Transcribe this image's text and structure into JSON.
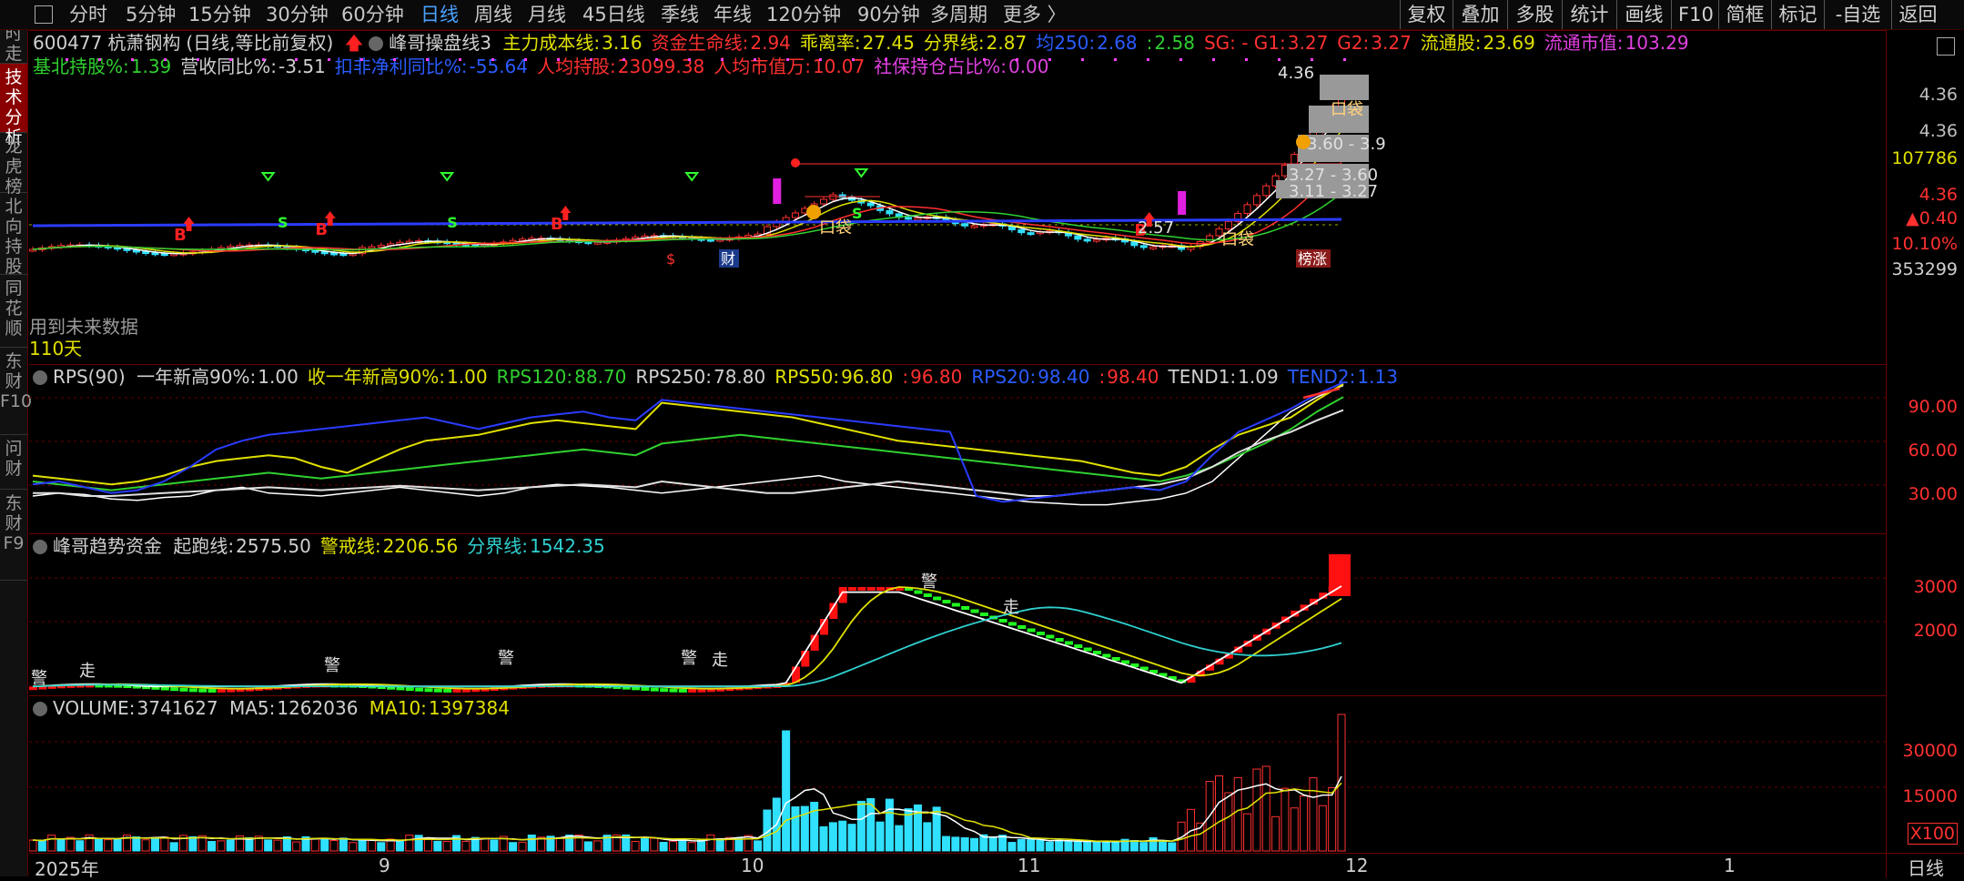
{
  "top_tabs": [
    "分时",
    "5分钟",
    "15分钟",
    "30分钟",
    "60分钟",
    "日线",
    "周线",
    "月线",
    "45日线",
    "季线",
    "年线",
    "120分钟",
    "90分钟",
    "多周期",
    "更多 〉"
  ],
  "active_tab": "日线",
  "right_buttons": [
    "复权",
    "叠加",
    "多股",
    "统计",
    "画线",
    "F10",
    "简框",
    "标记",
    "-自选",
    "返回"
  ],
  "left_tabs": [
    "分时走势",
    "技术分析",
    "龙虎榜",
    "北向持股",
    "同花顺",
    "东财F10",
    "问财",
    "东财F9"
  ],
  "stock": {
    "code": "600477",
    "name": "杭萧钢构",
    "mode": "(日线,等比前复权)",
    "indicator": "峰哥操盘线3",
    "line1": [
      {
        "t": "主力成本线:",
        "v": "3.16",
        "c": "#e0e000"
      },
      {
        "t": "资金生命线:",
        "v": "2.94",
        "c": "#ff3030"
      },
      {
        "t": "乖离率:",
        "v": "27.45",
        "c": "#e0e000"
      },
      {
        "t": "分界线:",
        "v": "2.87",
        "c": "#e0e000"
      },
      {
        "t": "均250:",
        "v": "2.68",
        "c": "#2a5cff"
      },
      {
        "t": ":",
        "v": "2.58",
        "c": "#30d030"
      },
      {
        "t": "SG: - G1:",
        "v": "3.27",
        "c": "#ff3030"
      },
      {
        "t": "G2:",
        "v": "3.27",
        "c": "#ff3030"
      },
      {
        "t": "流通股:",
        "v": "23.69",
        "c": "#e0e000"
      },
      {
        "t": "流通市值:",
        "v": "103.29",
        "c": "#e040e0"
      }
    ],
    "line2": [
      {
        "t": "基北持股%:",
        "v": "1.39",
        "c": "#30d030"
      },
      {
        "t": "营收同比%:",
        "v": "-3.51",
        "c": "#d0d0d0"
      },
      {
        "t": "扣非净利同比%:",
        "v": "-55.64",
        "c": "#2a5cff"
      },
      {
        "t": "人均持股:",
        "v": "23099.38",
        "c": "#ff3030"
      },
      {
        "t": "人均市值万:",
        "v": "10.07",
        "c": "#ff3030"
      },
      {
        "t": "社保持仓占比%:",
        "v": "0.00",
        "c": "#e040e0"
      }
    ],
    "warn": "用到未来数据",
    "days": "110天",
    "chip_labels": [
      "4.36",
      "3.60 - 3.9",
      "3.27 - 3.60",
      "3.11 - 3.27",
      "2.57",
      "口袋",
      "口袋",
      "口袋"
    ],
    "marker_s": "$",
    "marker_cai": "财",
    "marker_zt": "榜涨",
    "b_marks": [
      "B",
      "B",
      "B",
      "B"
    ],
    "s_marks": [
      "S",
      "S",
      "S"
    ],
    "axis": [
      "4.36",
      "107786",
      "4.36",
      "▲0.40",
      "10.10%",
      "353299"
    ]
  },
  "rps": {
    "title": "RPS(90)",
    "items": [
      {
        "t": "一年新高90%:",
        "v": "1.00",
        "c": "#d0d0d0"
      },
      {
        "t": "收一年新高90%:",
        "v": "1.00",
        "c": "#e0e000"
      },
      {
        "t": "RPS120:",
        "v": "88.70",
        "c": "#30d030"
      },
      {
        "t": "RPS250:",
        "v": "78.80",
        "c": "#d0d0d0"
      },
      {
        "t": "RPS50:",
        "v": "96.80",
        "c": "#e0e000"
      },
      {
        "t": ":",
        "v": "96.80",
        "c": "#ff3030"
      },
      {
        "t": "RPS20:",
        "v": "98.40",
        "c": "#2a5cff"
      },
      {
        "t": ":",
        "v": "98.40",
        "c": "#ff3030"
      },
      {
        "t": "TEND1:",
        "v": "1.09",
        "c": "#d0d0d0"
      },
      {
        "t": "TEND2:",
        "v": "1.13",
        "c": "#2a5cff"
      }
    ],
    "axis": [
      "90.00",
      "60.00",
      "30.00"
    ]
  },
  "trend": {
    "title": "峰哥趋势资金",
    "items": [
      {
        "t": "起跑线:",
        "v": "2575.50",
        "c": "#d0d0d0"
      },
      {
        "t": "警戒线:",
        "v": "2206.56",
        "c": "#e0e000"
      },
      {
        "t": "分界线:",
        "v": "1542.35",
        "c": "#30d0d0"
      }
    ],
    "marks": [
      "警",
      "走",
      "警",
      "警",
      "警",
      "走",
      "警",
      "走"
    ],
    "axis": [
      "3000",
      "2000"
    ]
  },
  "volume": {
    "title": "VOLUME:",
    "value": "3741627",
    "ma5_label": "MA5:",
    "ma5": "1262036",
    "ma10_label": "MA10:",
    "ma10": "1397384",
    "axis": [
      "30000",
      "15000",
      "X100"
    ]
  },
  "xaxis": [
    "2025年",
    "9",
    "10",
    "11",
    "12",
    "1"
  ],
  "xaxis_right": "日线",
  "chart_data": {
    "type": "line",
    "series": [
      {
        "name": "RPS(90)",
        "values": [
          20,
          22,
          21,
          18,
          17,
          19,
          20,
          24,
          26,
          22,
          21,
          20,
          22,
          24,
          26,
          24,
          22,
          20,
          22,
          26,
          28,
          27,
          26,
          24,
          22,
          24,
          26,
          28,
          30,
          32,
          34,
          30,
          28,
          26,
          24,
          22,
          20,
          18,
          16,
          15,
          14,
          14,
          16,
          18,
          22,
          30,
          46,
          62,
          78,
          88,
          96
        ]
      },
      {
        "name": "RPS120",
        "values": [
          30,
          28,
          26,
          24,
          26,
          28,
          30,
          32,
          34,
          36,
          34,
          32,
          34,
          36,
          38,
          40,
          42,
          44,
          46,
          48,
          50,
          52,
          50,
          48,
          56,
          58,
          60,
          62,
          60,
          58,
          56,
          54,
          52,
          50,
          48,
          46,
          44,
          42,
          40,
          38,
          36,
          34,
          32,
          30,
          34,
          40,
          48,
          56,
          66,
          78,
          88
        ]
      },
      {
        "name": "RPS250",
        "values": [
          22,
          22,
          20,
          20,
          21,
          22,
          23,
          24,
          25,
          26,
          25,
          24,
          25,
          26,
          27,
          26,
          25,
          24,
          25,
          26,
          27,
          28,
          27,
          26,
          30,
          28,
          26,
          24,
          22,
          22,
          24,
          26,
          28,
          30,
          28,
          26,
          24,
          22,
          20,
          20,
          22,
          24,
          26,
          28,
          32,
          40,
          50,
          58,
          64,
          72,
          79
        ]
      },
      {
        "name": "RPS50",
        "values": [
          34,
          32,
          30,
          28,
          30,
          34,
          40,
          44,
          46,
          48,
          46,
          40,
          36,
          44,
          52,
          58,
          60,
          62,
          66,
          70,
          72,
          70,
          68,
          66,
          84,
          82,
          80,
          78,
          76,
          74,
          70,
          66,
          62,
          58,
          56,
          54,
          52,
          50,
          48,
          46,
          44,
          40,
          36,
          34,
          40,
          52,
          62,
          68,
          74,
          86,
          97
        ]
      },
      {
        "name": "RPS20",
        "values": [
          28,
          30,
          26,
          22,
          24,
          30,
          40,
          52,
          58,
          62,
          64,
          66,
          68,
          70,
          72,
          74,
          70,
          66,
          70,
          74,
          76,
          78,
          74,
          72,
          86,
          84,
          82,
          80,
          78,
          76,
          74,
          72,
          70,
          68,
          66,
          64,
          20,
          16,
          18,
          20,
          22,
          24,
          26,
          24,
          30,
          48,
          64,
          72,
          80,
          90,
          98
        ]
      }
    ],
    "ylim": [
      0,
      110
    ]
  }
}
